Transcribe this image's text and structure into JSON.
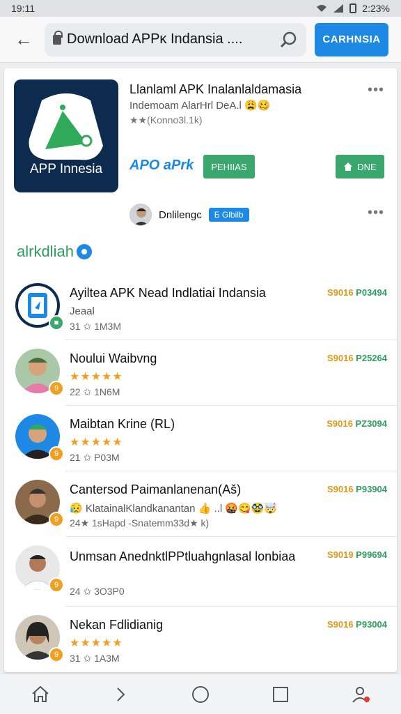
{
  "status": {
    "time": "19:11",
    "right_time": "2:23%"
  },
  "browser": {
    "url": "Download APPĸ Indansia ....",
    "cta_label": "CARHNSIA"
  },
  "hero": {
    "icon_label": "APP Innesia",
    "title": "Llanlaml APK Inalanlaldamasia",
    "subtitle": "Indemoam AlarHrl DeA.l 😩🥴",
    "rating": "★★(Konno3l.1k)",
    "dev_link": "APO aPrk",
    "green_button": "PEHIIAS",
    "install_button": "DNE",
    "author_name": "Dnlilengc",
    "author_tag": "Ƃ Glbilb"
  },
  "section": {
    "title": "alrkdliah"
  },
  "items": [
    {
      "name": "Ayiltea APK Nead Indlatiai Indansia",
      "line2": "Jeaal",
      "meta": "31 ✩ 1M3M",
      "price1": "S9016",
      "price2": "P03494",
      "badge": ""
    },
    {
      "name": "Noului Waibvng",
      "stars": "★★★★★",
      "meta": "22 ✩ 1N6M",
      "price1": "S9016",
      "price2": "P25264",
      "badge": "9"
    },
    {
      "name": "Maibtan Krine (RL)",
      "stars": "★★★★★",
      "meta": "21 ✩ P03M",
      "price1": "S9016",
      "price2": "PZ3094",
      "badge": "9"
    },
    {
      "name": "Cantersod Paimanlanenan(Aš)",
      "line2": "😥 KlatainalKlandkanantan 👍 ..l 🤬😋🥸🤯",
      "meta": "24★ 1sHapd  -Snatemm33d★ k)",
      "price1": "S9016",
      "price2": "P93904",
      "badge": "9"
    },
    {
      "name": "Unmsan AnednktlPPtluahgnlasal lonbiaa",
      "meta": "24 ✩ 3O3P0",
      "price1": "S9019",
      "price2": "P99694",
      "badge": "9"
    },
    {
      "name": "Nekan Fdlidianig",
      "stars": "★★★★★",
      "meta": "31 ✩ 1A3M",
      "price1": "S9016",
      "price2": "P93004",
      "badge": "9"
    }
  ]
}
